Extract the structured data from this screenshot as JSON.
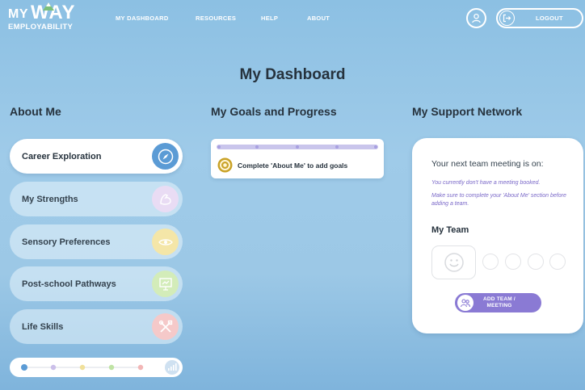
{
  "brand": {
    "logo_my": "MY",
    "logo_way": "WAY",
    "logo_sub": "EMPLOYABILITY"
  },
  "nav": [
    {
      "label": "MY DASHBOARD"
    },
    {
      "label": "RESOURCES"
    },
    {
      "label": "HELP"
    },
    {
      "label": "ABOUT"
    }
  ],
  "header": {
    "logout_label": "LOGOUT"
  },
  "page_title": "My Dashboard",
  "columns": {
    "about": "About Me",
    "goals": "My Goals and Progress",
    "support": "My Support Network"
  },
  "about_items": [
    {
      "label": "Career Exploration",
      "icon": "compass-icon",
      "color": "#5b9bd5",
      "active": true
    },
    {
      "label": "My Strengths",
      "icon": "flexed-arm-icon",
      "color": "#e6d8f2",
      "active": false
    },
    {
      "label": "Sensory Preferences",
      "icon": "sensory-icon",
      "color": "#f3e3a4",
      "active": false
    },
    {
      "label": "Post-school Pathways",
      "icon": "presentation-board-icon",
      "color": "#cfeab4",
      "active": false
    },
    {
      "label": "Life Skills",
      "icon": "tools-icon",
      "color": "#f4c6c6",
      "active": false
    }
  ],
  "about_progress": {
    "completed_steps": 1,
    "dot_colors": [
      "#5b9bd5",
      "#cbbfe9",
      "#f0e09a",
      "#bfe3a4",
      "#f2b6b6"
    ]
  },
  "goals": {
    "empty_text": "Complete 'About Me' to add goals",
    "accent": "#c9a227"
  },
  "support": {
    "meeting_title": "Your next team meeting is on:",
    "no_meeting": "You currently don't have a meeting booked.",
    "complete_note": "Make sure to complete your 'About Me' section before adding a team.",
    "team_title": "My Team",
    "add_button_line1": "ADD TEAM /",
    "add_button_line2": "MEETING",
    "accent": "#8a7ad4"
  }
}
